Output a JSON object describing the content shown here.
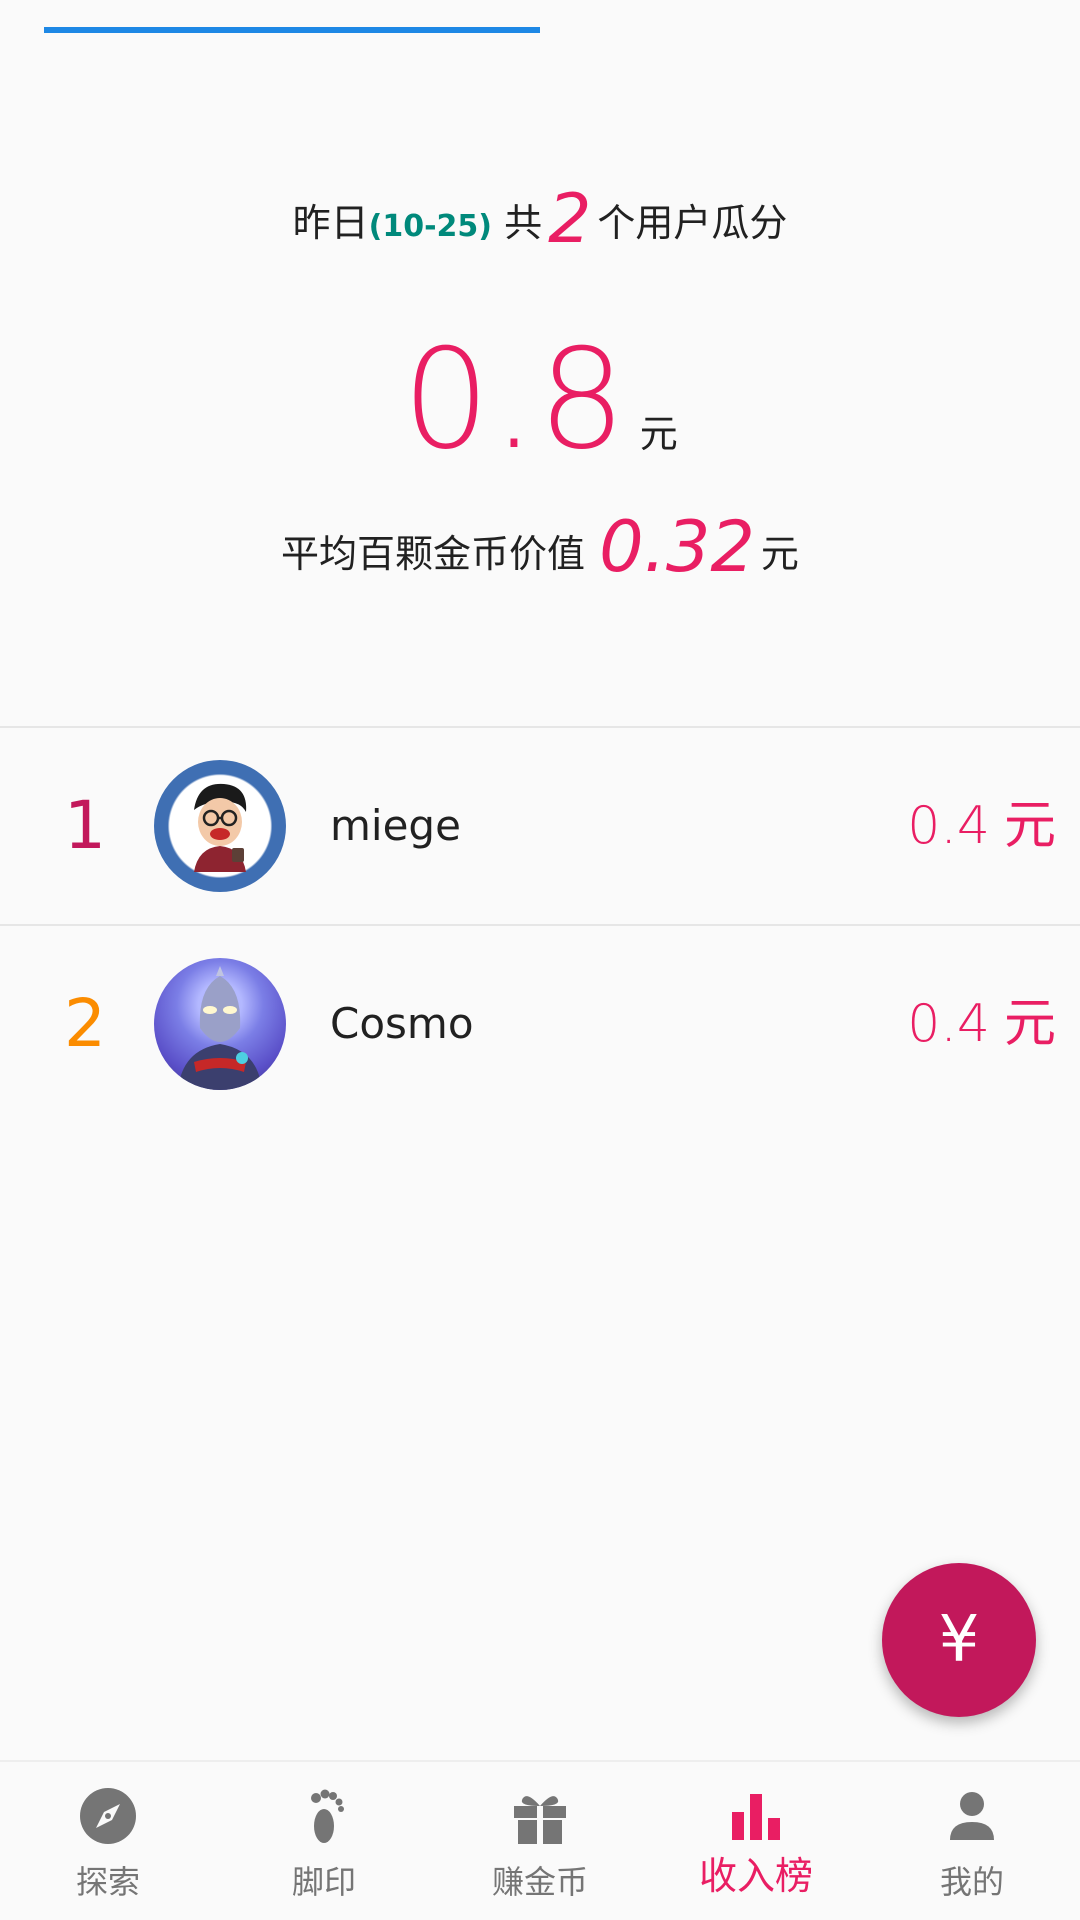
{
  "summary": {
    "prefix": "昨日",
    "date": "(10-25)",
    "mid": "共",
    "user_count": "2",
    "suffix": "个用户瓜分"
  },
  "total": {
    "amount": "0.8",
    "unit": "元"
  },
  "average": {
    "label": "平均百颗金币价值",
    "value": "0.32",
    "unit": "元"
  },
  "ranking": [
    {
      "rank": "1",
      "name": "miege",
      "income": "0.4",
      "unit": "元"
    },
    {
      "rank": "2",
      "name": "Cosmo",
      "income": "0.4",
      "unit": "元"
    }
  ],
  "fab": {
    "symbol": "¥",
    "icon": "yuan-icon"
  },
  "nav": {
    "items": [
      {
        "label": "探索",
        "icon": "compass-icon"
      },
      {
        "label": "脚印",
        "icon": "footprint-icon"
      },
      {
        "label": "赚金币",
        "icon": "gift-icon"
      },
      {
        "label": "收入榜",
        "icon": "bar-chart-icon",
        "active": true
      },
      {
        "label": "我的",
        "icon": "person-icon"
      }
    ]
  },
  "colors": {
    "accent": "#e91e63",
    "accent_dark": "#c2185b",
    "date_teal": "#00897b",
    "rank2_orange": "#fb8c00",
    "progress_blue": "#1e88e5"
  }
}
